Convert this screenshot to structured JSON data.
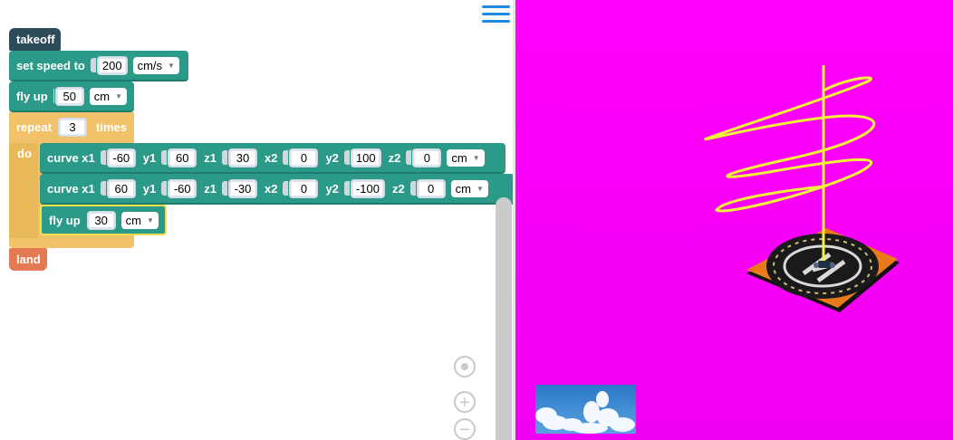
{
  "blocks": {
    "takeoff": "takeoff",
    "set_speed": {
      "label": "set speed to",
      "value": "200",
      "unit": "cm/s"
    },
    "fly_up_1": {
      "label": "fly up",
      "value": "50",
      "unit": "cm"
    },
    "repeat": {
      "label": "repeat",
      "times_value": "3",
      "times_label": "times",
      "do_label": "do"
    },
    "curve_1": {
      "x1_label": "curve x1",
      "x1": "-60",
      "y1_label": "y1",
      "y1": "60",
      "z1_label": "z1",
      "z1": "30",
      "x2_label": "x2",
      "x2": "0",
      "y2_label": "y2",
      "y2": "100",
      "z2_label": "z2",
      "z2": "0",
      "unit": "cm"
    },
    "curve_2": {
      "x1_label": "curve x1",
      "x1": "60",
      "y1_label": "y1",
      "y1": "-60",
      "z1_label": "z1",
      "z1": "-30",
      "x2_label": "x2",
      "x2": "0",
      "y2_label": "y2",
      "y2": "-100",
      "z2_label": "z2",
      "z2": "0",
      "unit": "cm"
    },
    "fly_up_2": {
      "label": "fly up",
      "value": "30",
      "unit": "cm"
    },
    "land": "land"
  },
  "zoom": {
    "in": "+",
    "out": "−"
  },
  "icons": [
    "menu-icon",
    "recenter-icon",
    "zoom-in-icon",
    "zoom-out-icon"
  ],
  "colors": {
    "workspace": "#ffffff",
    "viewport": "#ff00ff",
    "flight_path": "#f2f23a",
    "teal_block": "#2b9a88",
    "repeat_block": "#f2c26a",
    "takeoff_block": "#2d4b59",
    "land_block": "#e37a53"
  }
}
